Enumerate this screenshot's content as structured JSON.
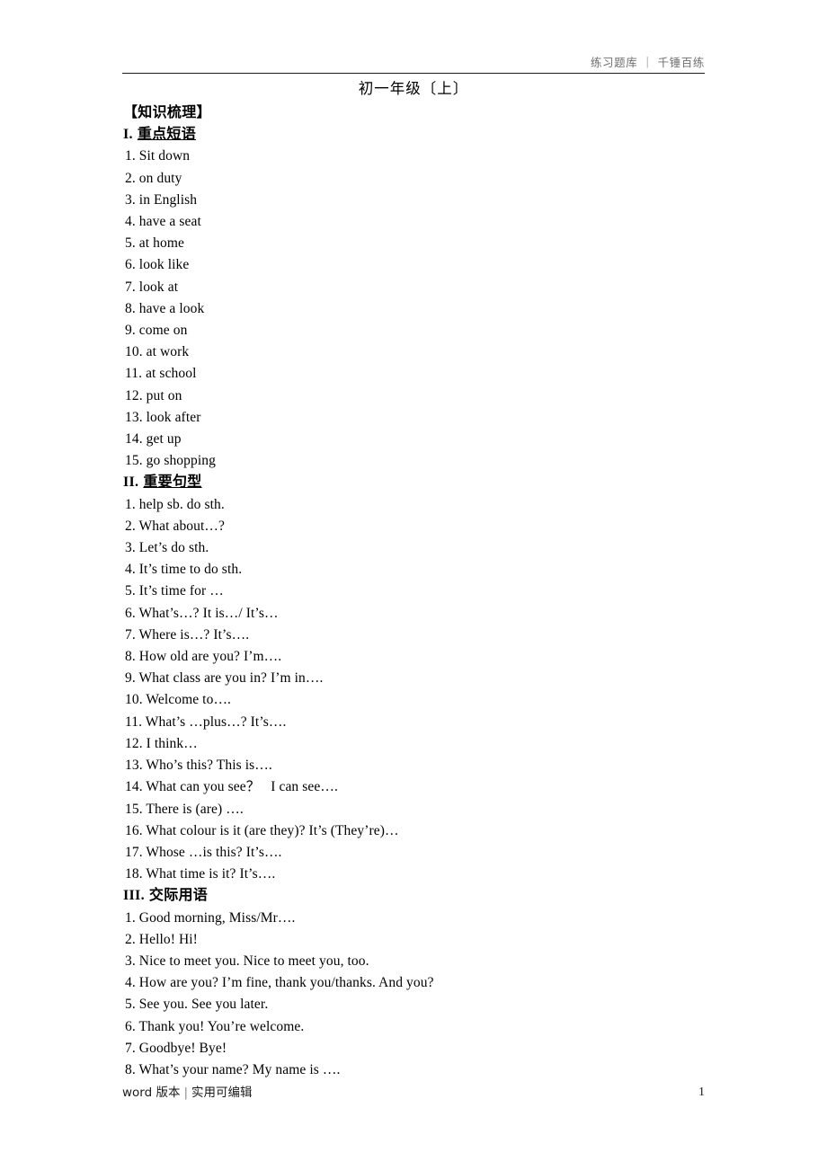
{
  "header": {
    "left_label": "练习题库",
    "separator": "|",
    "right_label": "千锤百练",
    "full_text": "练习题库 ｜ 千锤百练"
  },
  "title": "初一年级〔上〕",
  "bracket_heading": "【知识梳理】",
  "sections": [
    {
      "roman": "I.",
      "name": "重点短语",
      "underlined": true,
      "items": [
        "1. Sit down",
        "2. on duty",
        "3. in English",
        "4. have a seat",
        "5. at home",
        "6. look like",
        "7. look at",
        "8. have a look",
        "9. come on",
        "10. at work",
        "11. at school",
        "12. put on",
        "13. look after",
        "14. get up",
        "15. go shopping"
      ]
    },
    {
      "roman": "II.",
      "name": "重要句型",
      "underlined": true,
      "items": [
        "1. help sb. do sth.",
        "2. What about…?",
        "3. Let’s do sth.",
        "4. It’s time to do sth.",
        "5. It’s time for …",
        "6. What’s…? It is…/ It’s…",
        "7. Where is…? It’s….",
        "8. How old are you? I’m….",
        "9. What class are you in? I’m in….",
        "10. Welcome to….",
        "11. What’s …plus…? It’s….",
        "12. I think…",
        "13. Who’s this? This is….",
        "14. What can you see？   I can see….",
        "15. There is (are) ….",
        "16. What colour is it (are they)? It’s (They’re)…",
        "17. Whose …is this? It’s….",
        "18. What time is it? It’s…."
      ]
    },
    {
      "roman": "III.",
      "name": "交际用语",
      "underlined": false,
      "items": [
        "1. Good morning, Miss/Mr….",
        "2. Hello! Hi!",
        "3. Nice to meet you. Nice to meet you, too.",
        "4. How are you? I’m fine, thank you/thanks. And you?",
        "5. See you. See you later.",
        "6. Thank you! You’re welcome.",
        "7. Goodbye! Bye!",
        "8. What’s your name? My name is …."
      ]
    }
  ],
  "footer": {
    "label_left": "word 版本",
    "separator": "|",
    "label_right": "实用可编辑",
    "page_number": "1"
  }
}
